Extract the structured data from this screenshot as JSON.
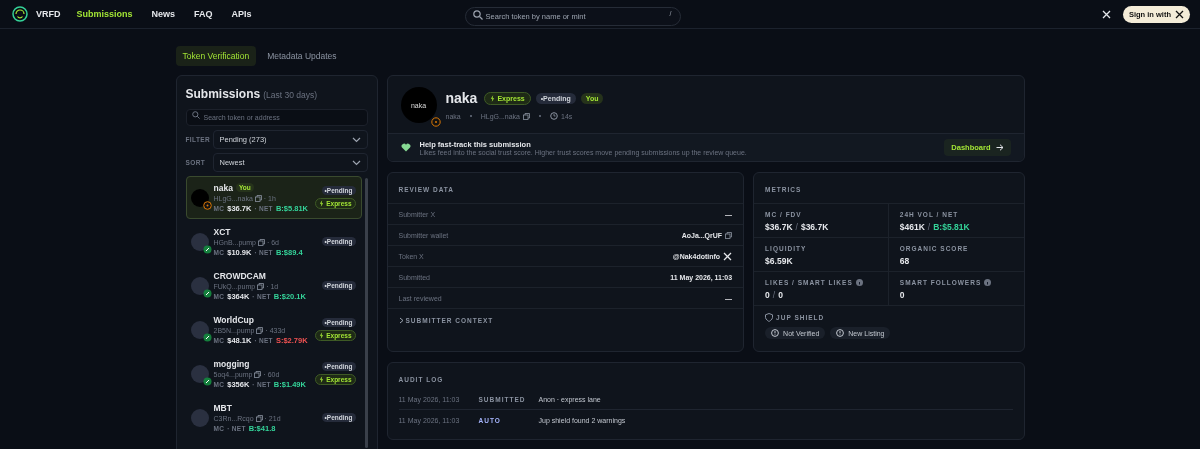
{
  "nav": {
    "brand": "VRFD",
    "links": [
      {
        "label": "Submissions",
        "selected": true
      },
      {
        "label": "News",
        "selected": false
      },
      {
        "label": "FAQ",
        "selected": false
      },
      {
        "label": "APIs",
        "selected": false
      }
    ],
    "search": {
      "placeholder": "Search token by name or mint",
      "shortcut": "/"
    },
    "sign_in": "Sign in with"
  },
  "tabs": [
    {
      "label": "Token Verification",
      "selected": true
    },
    {
      "label": "Metadata Updates",
      "selected": false
    }
  ],
  "submissions": {
    "title": "Submissions",
    "subtitle": "(Last 30 days)",
    "search": {
      "placeholder": "Search token or address"
    },
    "filter": {
      "label": "FILTER",
      "value": "Pending (273)"
    },
    "sort": {
      "label": "SORT",
      "value": "Newest"
    },
    "items": [
      {
        "name": "naka",
        "you": "You",
        "address": "HLgG...naka",
        "age": "· 1h",
        "mc_label": "MC",
        "mc": "$36.7K",
        "net_label": "· NET",
        "net": "B:$5.81K",
        "color": "#34d399",
        "pending": "•Pending",
        "express": "Express",
        "kind": "clock",
        "selected": true
      },
      {
        "name": "XCT",
        "address": "HGnB...pump",
        "age": "· 6d",
        "mc_label": "MC",
        "mc": "$10.9K",
        "net_label": "· NET",
        "net": "B:$89.4",
        "color": "#34d399",
        "pending": "•Pending",
        "kind": "link",
        "selected": false
      },
      {
        "name": "CROWDCAM",
        "address": "FUkQ...pump",
        "age": "· 1d",
        "mc_label": "MC",
        "mc": "$364K",
        "net_label": "· NET",
        "net": "B:$20.1K",
        "color": "#34d399",
        "pending": "•Pending",
        "kind": "link",
        "selected": false
      },
      {
        "name": "WorldCup",
        "address": "2B5N...pump",
        "age": "· 433d",
        "mc_label": "MC",
        "mc": "$48.1K",
        "net_label": "· NET",
        "net": "S:$2.79K",
        "color": "#f05252",
        "pending": "•Pending",
        "express": "Express",
        "kind": "link",
        "selected": false
      },
      {
        "name": "mogging",
        "address": "5oq4...pump",
        "age": "· 60d",
        "mc_label": "MC",
        "mc": "$356K",
        "net_label": "· NET",
        "net": "B:$1.49K",
        "color": "#34d399",
        "pending": "•Pending",
        "express": "Express",
        "kind": "link",
        "selected": false
      },
      {
        "name": "MBT",
        "address": "C3Rn...Rcqo",
        "age": "· 21d",
        "mc_label": "MC",
        "net_label": "· NET",
        "net": "B:$41.8",
        "color": "#34d399",
        "pending": "•Pending",
        "kind": "plain",
        "selected": false
      }
    ]
  },
  "token": {
    "name": "naka",
    "express": "Express",
    "pending": "•Pending",
    "you": "You",
    "avatar_text": "naka",
    "symbol": "naka",
    "address": "HLgG...naka",
    "age": "14s"
  },
  "help": {
    "title": "Help fast-track this submission",
    "text": "Likes feed into the social trust score. Higher trust scores move pending submissions up the review queue.",
    "button": "Dashboard"
  },
  "review": {
    "title": "REVIEW DATA",
    "rows": [
      {
        "label": "Submitter X",
        "value": "—",
        "kind": "plain"
      },
      {
        "label": "Submitter wallet",
        "value": "AoJa...QrUF",
        "kind": "copy"
      },
      {
        "label": "Token X",
        "value": "@Nak4dotinfo",
        "kind": "x"
      },
      {
        "label": "Submitted",
        "value": "11 May 2026, 11:03",
        "kind": "plain"
      },
      {
        "label": "Last reviewed",
        "value": "—",
        "kind": "plain"
      }
    ],
    "context": "SUBMITTER CONTEXT",
    "expanded": false
  },
  "metrics": {
    "title": "METRICS",
    "cells": [
      {
        "label": "MC / FDV",
        "values": [
          "$36.7K",
          "/",
          "$36.7K"
        ],
        "info": false
      },
      {
        "label": "24H VOL / NET",
        "values": [
          "$461K",
          "/",
          "B:$5.81K"
        ],
        "info": false
      },
      {
        "label": "LIQUIDITY",
        "values": [
          "$6.59K"
        ],
        "info": false
      },
      {
        "label": "ORGANIC SCORE",
        "values": [
          "68"
        ],
        "info": false
      },
      {
        "label": "LIKES / SMART LIKES",
        "values": [
          "0",
          "/",
          "0"
        ],
        "info": true
      },
      {
        "label": "SMART FOLLOWERS",
        "values": [
          "0"
        ],
        "info": true
      }
    ],
    "shield": {
      "label": "JUP SHIELD",
      "tags": [
        "Not Verified",
        "New Listing"
      ]
    }
  },
  "audit": {
    "title": "AUDIT LOG",
    "rows": [
      {
        "time": "11 May 2026, 11:03",
        "kind": "submitted",
        "type": "SUBMITTED",
        "text": "Anon · express lane"
      },
      {
        "time": "11 May 2026, 11:03",
        "kind": "auto",
        "type": "AUTO",
        "text": "Jup shield found 2 warnings"
      }
    ]
  }
}
